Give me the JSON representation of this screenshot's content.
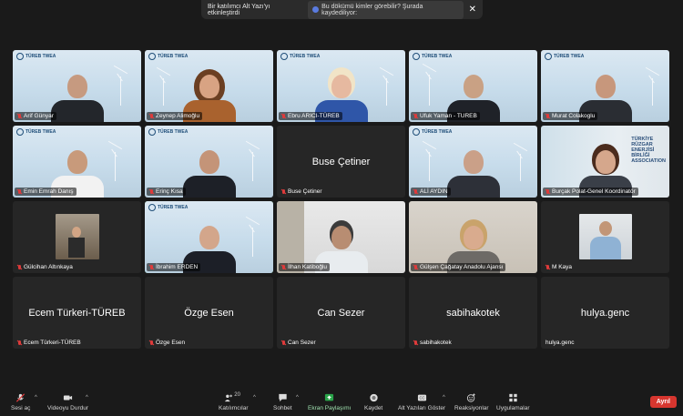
{
  "banner": {
    "message": "Bir katılımcı Alt Yazı'yı etkinleştirdi",
    "chip_text": "Bu dökümü kimler görebilir? Şurada kaydediliyor:",
    "close_glyph": "✕"
  },
  "participants": [
    {
      "name": "Arif Günyar",
      "muted": true
    },
    {
      "name": "Zeynep Alimoğlu",
      "muted": true
    },
    {
      "name": "Ebru ARICI-TÜREB",
      "muted": true
    },
    {
      "name": "Ufuk Yaman - TUREB",
      "muted": true
    },
    {
      "name": "Murat Colakoglu",
      "muted": true
    },
    {
      "name": "Emin Emrah Danış",
      "muted": true
    },
    {
      "name": "Erinç Kısa",
      "muted": true
    },
    {
      "name": "Buse Çetiner",
      "muted": true,
      "video_off": true
    },
    {
      "name": "ALİ AYDIN",
      "muted": true
    },
    {
      "name": "Burçak Polat-Genel Koordinatör",
      "muted": true
    },
    {
      "name": "Gülcihan Altınkaya",
      "muted": true
    },
    {
      "name": "İbrahim ERDEN",
      "muted": true,
      "active_speaker": true
    },
    {
      "name": "İlhan Katiboğlu",
      "muted": true
    },
    {
      "name": "Gülşen Çağatay Anadolu Ajansı",
      "muted": true
    },
    {
      "name": "M Kaya",
      "muted": true
    },
    {
      "name": "Ecem Türkeri-TÜREB",
      "muted": true,
      "video_off": true
    },
    {
      "name": "Özge Esen",
      "muted": true,
      "video_off": true
    },
    {
      "name": "Can Sezer",
      "muted": true,
      "video_off": true
    },
    {
      "name": "sabihakotek",
      "muted": true,
      "video_off": true
    },
    {
      "name": "hulya.genc",
      "muted": false,
      "video_off": true
    }
  ],
  "logo_text": "TÜREB TWEA",
  "tureb_banner": {
    "line1": "TÜRKİYE",
    "line2": "RÜZGAR",
    "line3": "ENERJİSİ",
    "line4": "BİRLİĞİ",
    "line5": "ASSOCIATION"
  },
  "toolbar": {
    "unmute_label": "Sesi aç",
    "video_label": "Videoyu Durdur",
    "participants_label": "Katılımcılar",
    "participants_count": "20",
    "chat_label": "Sohbet",
    "share_label": "Ekran Paylaşımı",
    "record_label": "Kaydet",
    "captions_label": "Alt Yazıları Göster",
    "reactions_label": "Reaksiyonlar",
    "apps_label": "Uygulamalar",
    "leave_label": "Ayrıl"
  },
  "colors": {
    "accent_green": "#2aa44a",
    "leave_red": "#d7362f",
    "mute_red": "#e03b3b"
  }
}
